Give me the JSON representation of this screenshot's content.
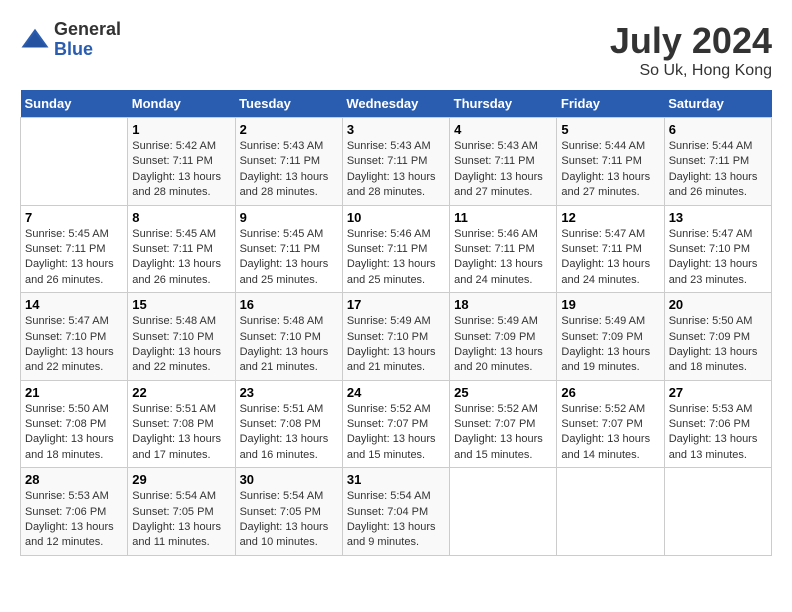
{
  "header": {
    "logo_general": "General",
    "logo_blue": "Blue",
    "month_year": "July 2024",
    "location": "So Uk, Hong Kong"
  },
  "weekdays": [
    "Sunday",
    "Monday",
    "Tuesday",
    "Wednesday",
    "Thursday",
    "Friday",
    "Saturday"
  ],
  "weeks": [
    [
      {
        "day": "",
        "sunrise": "",
        "sunset": "",
        "daylight": ""
      },
      {
        "day": "1",
        "sunrise": "Sunrise: 5:42 AM",
        "sunset": "Sunset: 7:11 PM",
        "daylight": "Daylight: 13 hours and 28 minutes."
      },
      {
        "day": "2",
        "sunrise": "Sunrise: 5:43 AM",
        "sunset": "Sunset: 7:11 PM",
        "daylight": "Daylight: 13 hours and 28 minutes."
      },
      {
        "day": "3",
        "sunrise": "Sunrise: 5:43 AM",
        "sunset": "Sunset: 7:11 PM",
        "daylight": "Daylight: 13 hours and 28 minutes."
      },
      {
        "day": "4",
        "sunrise": "Sunrise: 5:43 AM",
        "sunset": "Sunset: 7:11 PM",
        "daylight": "Daylight: 13 hours and 27 minutes."
      },
      {
        "day": "5",
        "sunrise": "Sunrise: 5:44 AM",
        "sunset": "Sunset: 7:11 PM",
        "daylight": "Daylight: 13 hours and 27 minutes."
      },
      {
        "day": "6",
        "sunrise": "Sunrise: 5:44 AM",
        "sunset": "Sunset: 7:11 PM",
        "daylight": "Daylight: 13 hours and 26 minutes."
      }
    ],
    [
      {
        "day": "7",
        "sunrise": "Sunrise: 5:45 AM",
        "sunset": "Sunset: 7:11 PM",
        "daylight": "Daylight: 13 hours and 26 minutes."
      },
      {
        "day": "8",
        "sunrise": "Sunrise: 5:45 AM",
        "sunset": "Sunset: 7:11 PM",
        "daylight": "Daylight: 13 hours and 26 minutes."
      },
      {
        "day": "9",
        "sunrise": "Sunrise: 5:45 AM",
        "sunset": "Sunset: 7:11 PM",
        "daylight": "Daylight: 13 hours and 25 minutes."
      },
      {
        "day": "10",
        "sunrise": "Sunrise: 5:46 AM",
        "sunset": "Sunset: 7:11 PM",
        "daylight": "Daylight: 13 hours and 25 minutes."
      },
      {
        "day": "11",
        "sunrise": "Sunrise: 5:46 AM",
        "sunset": "Sunset: 7:11 PM",
        "daylight": "Daylight: 13 hours and 24 minutes."
      },
      {
        "day": "12",
        "sunrise": "Sunrise: 5:47 AM",
        "sunset": "Sunset: 7:11 PM",
        "daylight": "Daylight: 13 hours and 24 minutes."
      },
      {
        "day": "13",
        "sunrise": "Sunrise: 5:47 AM",
        "sunset": "Sunset: 7:10 PM",
        "daylight": "Daylight: 13 hours and 23 minutes."
      }
    ],
    [
      {
        "day": "14",
        "sunrise": "Sunrise: 5:47 AM",
        "sunset": "Sunset: 7:10 PM",
        "daylight": "Daylight: 13 hours and 22 minutes."
      },
      {
        "day": "15",
        "sunrise": "Sunrise: 5:48 AM",
        "sunset": "Sunset: 7:10 PM",
        "daylight": "Daylight: 13 hours and 22 minutes."
      },
      {
        "day": "16",
        "sunrise": "Sunrise: 5:48 AM",
        "sunset": "Sunset: 7:10 PM",
        "daylight": "Daylight: 13 hours and 21 minutes."
      },
      {
        "day": "17",
        "sunrise": "Sunrise: 5:49 AM",
        "sunset": "Sunset: 7:10 PM",
        "daylight": "Daylight: 13 hours and 21 minutes."
      },
      {
        "day": "18",
        "sunrise": "Sunrise: 5:49 AM",
        "sunset": "Sunset: 7:09 PM",
        "daylight": "Daylight: 13 hours and 20 minutes."
      },
      {
        "day": "19",
        "sunrise": "Sunrise: 5:49 AM",
        "sunset": "Sunset: 7:09 PM",
        "daylight": "Daylight: 13 hours and 19 minutes."
      },
      {
        "day": "20",
        "sunrise": "Sunrise: 5:50 AM",
        "sunset": "Sunset: 7:09 PM",
        "daylight": "Daylight: 13 hours and 18 minutes."
      }
    ],
    [
      {
        "day": "21",
        "sunrise": "Sunrise: 5:50 AM",
        "sunset": "Sunset: 7:08 PM",
        "daylight": "Daylight: 13 hours and 18 minutes."
      },
      {
        "day": "22",
        "sunrise": "Sunrise: 5:51 AM",
        "sunset": "Sunset: 7:08 PM",
        "daylight": "Daylight: 13 hours and 17 minutes."
      },
      {
        "day": "23",
        "sunrise": "Sunrise: 5:51 AM",
        "sunset": "Sunset: 7:08 PM",
        "daylight": "Daylight: 13 hours and 16 minutes."
      },
      {
        "day": "24",
        "sunrise": "Sunrise: 5:52 AM",
        "sunset": "Sunset: 7:07 PM",
        "daylight": "Daylight: 13 hours and 15 minutes."
      },
      {
        "day": "25",
        "sunrise": "Sunrise: 5:52 AM",
        "sunset": "Sunset: 7:07 PM",
        "daylight": "Daylight: 13 hours and 15 minutes."
      },
      {
        "day": "26",
        "sunrise": "Sunrise: 5:52 AM",
        "sunset": "Sunset: 7:07 PM",
        "daylight": "Daylight: 13 hours and 14 minutes."
      },
      {
        "day": "27",
        "sunrise": "Sunrise: 5:53 AM",
        "sunset": "Sunset: 7:06 PM",
        "daylight": "Daylight: 13 hours and 13 minutes."
      }
    ],
    [
      {
        "day": "28",
        "sunrise": "Sunrise: 5:53 AM",
        "sunset": "Sunset: 7:06 PM",
        "daylight": "Daylight: 13 hours and 12 minutes."
      },
      {
        "day": "29",
        "sunrise": "Sunrise: 5:54 AM",
        "sunset": "Sunset: 7:05 PM",
        "daylight": "Daylight: 13 hours and 11 minutes."
      },
      {
        "day": "30",
        "sunrise": "Sunrise: 5:54 AM",
        "sunset": "Sunset: 7:05 PM",
        "daylight": "Daylight: 13 hours and 10 minutes."
      },
      {
        "day": "31",
        "sunrise": "Sunrise: 5:54 AM",
        "sunset": "Sunset: 7:04 PM",
        "daylight": "Daylight: 13 hours and 9 minutes."
      },
      {
        "day": "",
        "sunrise": "",
        "sunset": "",
        "daylight": ""
      },
      {
        "day": "",
        "sunrise": "",
        "sunset": "",
        "daylight": ""
      },
      {
        "day": "",
        "sunrise": "",
        "sunset": "",
        "daylight": ""
      }
    ]
  ]
}
